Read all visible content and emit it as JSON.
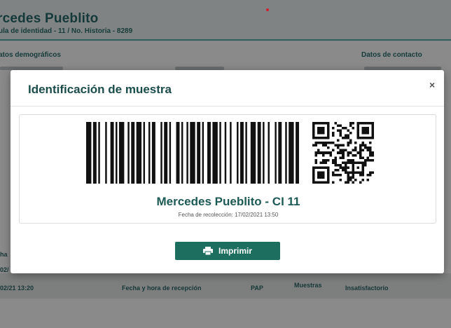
{
  "background": {
    "patient_name": "rcedes Pueblito",
    "patient_subtitle": "ula de identidad - 11 / No. Historia - 8289",
    "section_demographics": "atos demográficos",
    "section_contact": "Datos de contacto",
    "table": {
      "left_fragment_1": "ha",
      "left_fragment_2": "02/",
      "date_cell": "02/21 13:20",
      "reception_header": "Fecha y hora de recepción",
      "test_header": "PAP",
      "samples_tab": "Muestras",
      "status_cell": "Insatisfactorio"
    }
  },
  "modal": {
    "title": "Identificación de muestra",
    "close_label": "×",
    "label": {
      "patient_line": "Mercedes Pueblito - CI 11",
      "collection_line": "Fecha de recolección: 17/02/2021 13:50"
    },
    "print_label": "Imprimir",
    "print_icon": "printer-icon"
  },
  "colors": {
    "accent": "#1e6e60",
    "title_teal": "#1b4d4a",
    "header_rule": "#2f5f5a",
    "indicator_red": "#d0232f"
  }
}
